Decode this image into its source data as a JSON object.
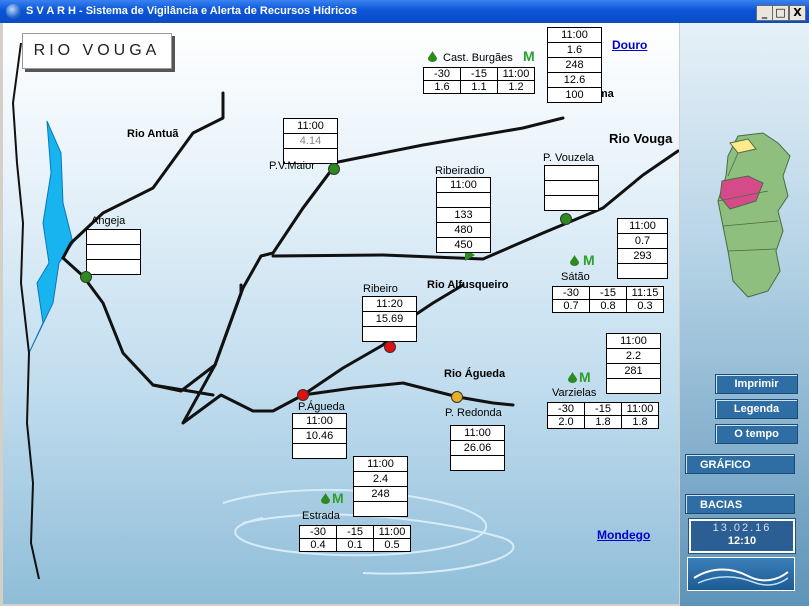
{
  "window": {
    "title": "S V A R H  -  Sistema de Vigilância e Alerta de Recursos Hídricos",
    "min": "_",
    "max": "□",
    "close": "X"
  },
  "main_button": "RIO VOUGA",
  "links": {
    "douro": "Douro",
    "mondego": "Mondego"
  },
  "rivers": {
    "antua": "Rio Antuã",
    "caima": "Rio Caima",
    "vouga": "Rio Vouga",
    "alfusqueiro": "Rio Alfusqueiro",
    "agueda": "Rio Águeda"
  },
  "stations": {
    "cast_burgaes": {
      "name": "Cast. Burgães",
      "marker": "M",
      "box": [
        "11:00",
        "1.6",
        "248",
        "12.6",
        "100"
      ],
      "headers": [
        "-30",
        "-15",
        "11:00"
      ],
      "values": [
        "1.6",
        "1.1",
        "1.2"
      ]
    },
    "pv_maior": {
      "name": "P.V.Maior",
      "box": [
        "11:00",
        "4.14",
        ""
      ]
    },
    "ribeiradio": {
      "name": "Ribeiradio",
      "box": [
        "11:00",
        "",
        "133",
        "480",
        "450"
      ]
    },
    "p_vouzela": {
      "name": "P. Vouzela",
      "box": [
        "",
        "",
        ""
      ]
    },
    "angeja": {
      "name": "Angeja",
      "box": [
        "",
        "",
        ""
      ]
    },
    "satao": {
      "name": "Sátão",
      "marker": "M",
      "box": [
        "11:00",
        "0.7",
        "293",
        ""
      ],
      "headers": [
        "-30",
        "-15",
        "11:15"
      ],
      "values": [
        "0.7",
        "0.8",
        "0.3"
      ]
    },
    "ribeiro": {
      "name": "Ribeiro",
      "box": [
        "11:20",
        "15.69",
        ""
      ]
    },
    "varzielas": {
      "name": "Varzielas",
      "marker": "M",
      "box": [
        "11:00",
        "2.2",
        "281",
        ""
      ],
      "headers": [
        "-30",
        "-15",
        "11:00"
      ],
      "values": [
        "2.0",
        "1.8",
        "1.8"
      ]
    },
    "p_agueda": {
      "name": "P.Águeda",
      "box": [
        "11:00",
        "10.46",
        ""
      ]
    },
    "p_redonda": {
      "name": "P. Redonda",
      "box": [
        "11:00",
        "26.06",
        ""
      ]
    },
    "estrada": {
      "name": "Estrada",
      "marker": "M",
      "box": [
        "11:00",
        "2.4",
        "248",
        ""
      ],
      "headers": [
        "-30",
        "-15",
        "11:00"
      ],
      "values": [
        "0.4",
        "0.1",
        "0.5"
      ]
    }
  },
  "sidebar": {
    "imprimir": "Imprimir",
    "legenda": "Legenda",
    "tempo": "O tempo",
    "grafico": "GRÁFICO",
    "bacias": "BACIAS",
    "date": "13.02.16",
    "time": "12:10"
  },
  "colors": {
    "titlebar": "#0a55d8",
    "sidebar_button": "#2f6ea4",
    "station_green": "#2d8a1e",
    "station_red": "#e01010",
    "station_yellow": "#e8b020",
    "river_blue": "#18b4f0",
    "link_blue": "#0000cc"
  }
}
